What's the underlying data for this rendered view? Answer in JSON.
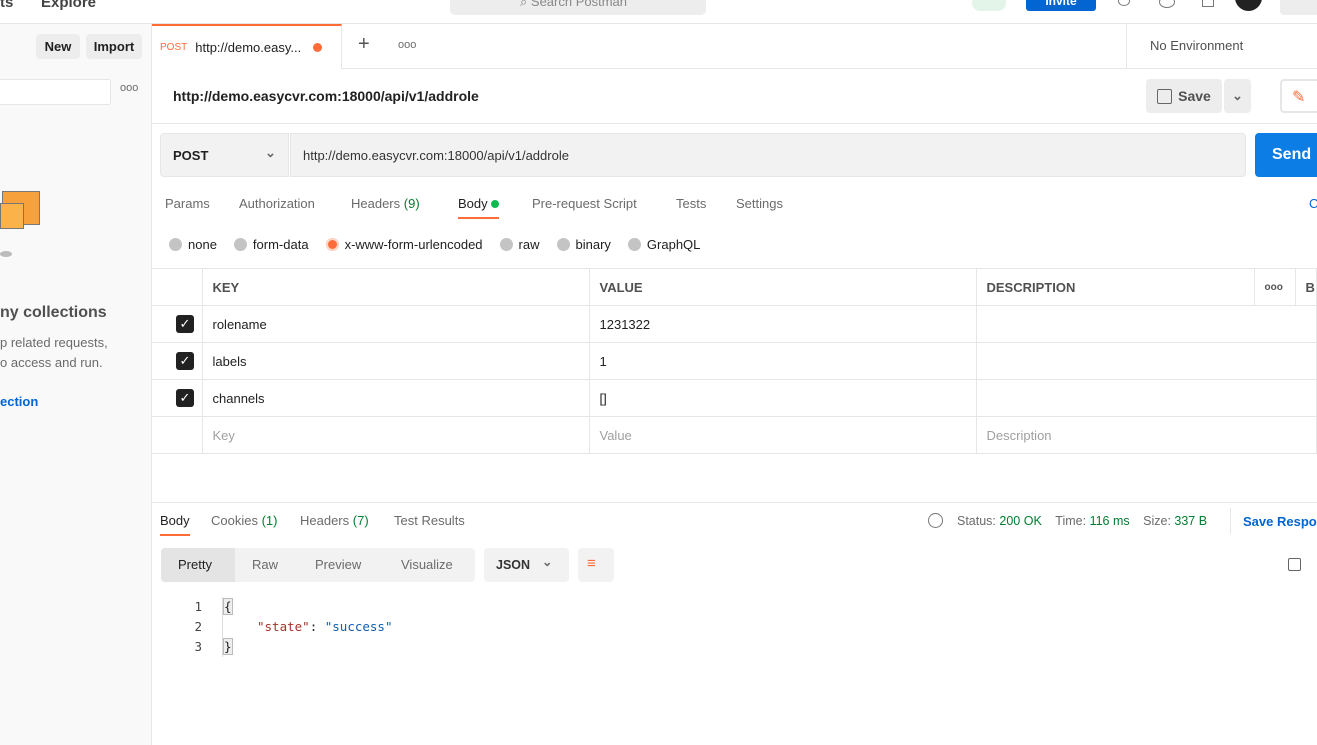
{
  "topbar": {
    "nav_partial": "ts",
    "explore": "Explore",
    "search_placeholder": "Search Postman",
    "invite": "Invite"
  },
  "sidebar": {
    "new": "New",
    "import": "Import",
    "empty_title": "ny collections",
    "empty_line1": "p related requests,",
    "empty_line2": "o access and run.",
    "create_link": "ection"
  },
  "tab": {
    "method": "POST",
    "title": "http://demo.easy...",
    "new_tab": "+",
    "more": "ooo"
  },
  "environment": "No Environment",
  "request": {
    "title": "http://demo.easycvr.com:18000/api/v1/addrole",
    "save": "Save",
    "method": "POST",
    "url": "http://demo.easycvr.com:18000/api/v1/addrole",
    "send": "Send",
    "cookies_partial": "C"
  },
  "subtabs": [
    {
      "label": "Params"
    },
    {
      "label": "Authorization"
    },
    {
      "label": "Headers",
      "count": "(9)"
    },
    {
      "label": "Body"
    },
    {
      "label": "Pre-request Script"
    },
    {
      "label": "Tests"
    },
    {
      "label": "Settings"
    }
  ],
  "body_types": [
    "none",
    "form-data",
    "x-www-form-urlencoded",
    "raw",
    "binary",
    "GraphQL"
  ],
  "body_selected": "x-www-form-urlencoded",
  "table": {
    "headers": [
      "KEY",
      "VALUE",
      "DESCRIPTION"
    ],
    "bulk_partial": "B",
    "more": "ooo",
    "rows": [
      {
        "key": "rolename",
        "value": "1231322",
        "checked": true
      },
      {
        "key": "labels",
        "value": "1",
        "checked": true
      },
      {
        "key": "channels",
        "value": "[]",
        "checked": true
      }
    ],
    "placeholders": {
      "key": "Key",
      "value": "Value",
      "description": "Description"
    }
  },
  "response": {
    "tabs": [
      {
        "label": "Body"
      },
      {
        "label": "Cookies",
        "count": "(1)"
      },
      {
        "label": "Headers",
        "count": "(7)"
      },
      {
        "label": "Test Results"
      }
    ],
    "status_label": "Status:",
    "status": "200 OK",
    "time_label": "Time:",
    "time": "116 ms",
    "size_label": "Size:",
    "size": "337 B",
    "save_response": "Save Respo",
    "views": [
      "Pretty",
      "Raw",
      "Preview",
      "Visualize"
    ],
    "format": "JSON",
    "lines": [
      "1",
      "2",
      "3"
    ],
    "open_brace": "{",
    "key": "\"state\"",
    "colon": ": ",
    "value": "\"success\"",
    "close_brace": "}"
  },
  "colors": {
    "accent": "#ff6c37",
    "blue": "#0265d2",
    "green": "#007f31"
  }
}
